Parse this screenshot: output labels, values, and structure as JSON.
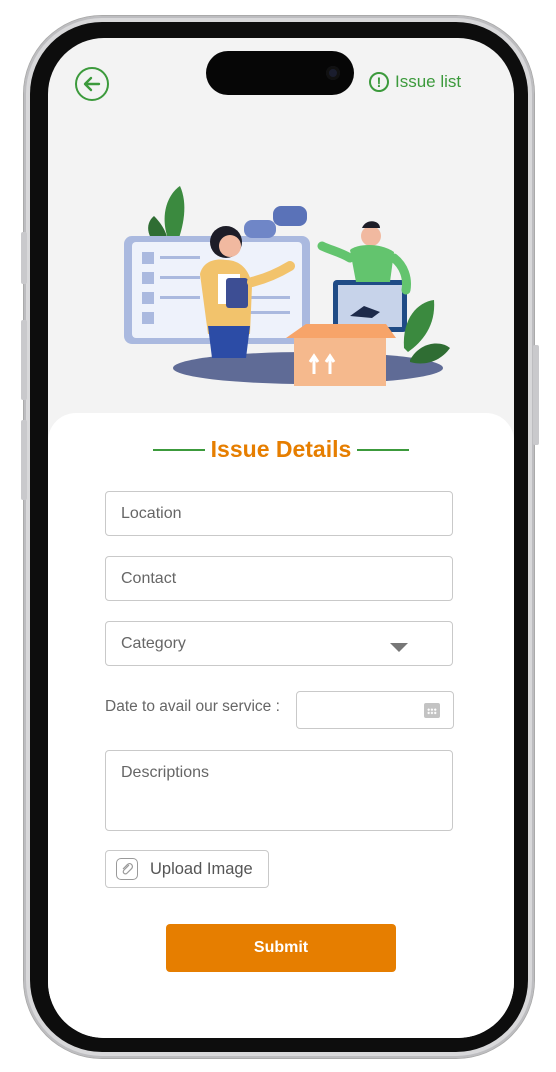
{
  "header": {
    "issue_list_label": "Issue list"
  },
  "form": {
    "title": "Issue Details",
    "location_placeholder": "Location",
    "contact_placeholder": "Contact",
    "category_placeholder": "Category",
    "date_label": "Date to avail our service :",
    "description_placeholder": "Descriptions",
    "upload_label": "Upload Image",
    "submit_label": "Submit"
  },
  "colors": {
    "accent_green": "#3c9a3c",
    "accent_orange": "#e67e00"
  },
  "icons": {
    "back": "arrow-left-circle-icon",
    "issue_list": "exclamation-circle-icon",
    "category": "chevron-down-icon",
    "date": "calendar-icon",
    "upload": "attachment-icon"
  }
}
